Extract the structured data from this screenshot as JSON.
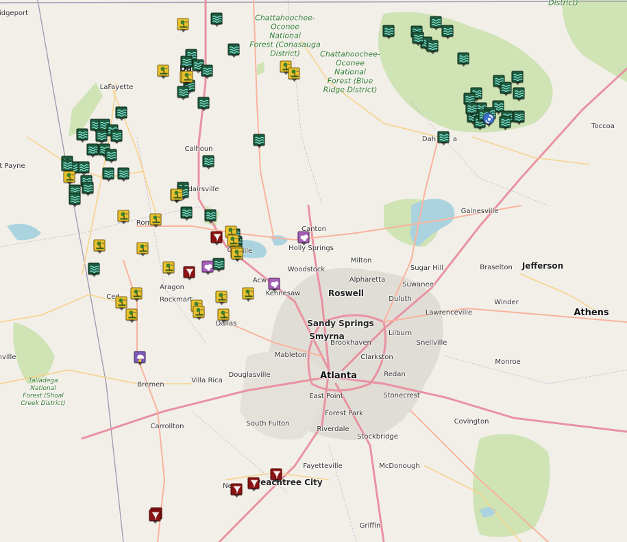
{
  "map": {
    "colors": {
      "land": "#f2efe9",
      "forest": "#c8dfad",
      "urban": "#dedbd6",
      "water": "#aad3df",
      "interstate": "#e892a2",
      "highway": "#f9b29c",
      "road": "#f7d28a"
    },
    "places": [
      {
        "name": "Bridgeport",
        "label": "idgeport"
      },
      {
        "name": "LaFayette",
        "label": "LaFayette"
      },
      {
        "name": "Fort Payne",
        "label": "t Payne"
      },
      {
        "name": "Dalton",
        "label": "Da"
      },
      {
        "name": "Calhoun",
        "label": "Calhoun"
      },
      {
        "name": "Adairsville",
        "label": "dairsville"
      },
      {
        "name": "Rome",
        "label": "Rom"
      },
      {
        "name": "Cartersville",
        "label": "Ca"
      },
      {
        "name": "Cartersville suffix",
        "label": "ville"
      },
      {
        "name": "Aragon",
        "label": "Aragon"
      },
      {
        "name": "Rockmart",
        "label": "Rockmart"
      },
      {
        "name": "Cedartown",
        "label": "Ced"
      },
      {
        "name": "Dallas",
        "label": "Dallas"
      },
      {
        "name": "Canton",
        "label": "Canton"
      },
      {
        "name": "Holly Springs",
        "label": "Holly Springs"
      },
      {
        "name": "Woodstock",
        "label": "Woodstock"
      },
      {
        "name": "Acworth",
        "label": "Acw"
      },
      {
        "name": "Kennesaw",
        "label": "Kennesaw"
      },
      {
        "name": "Milton",
        "label": "Milton"
      },
      {
        "name": "Alpharetta",
        "label": "Alpharetta"
      },
      {
        "name": "Roswell",
        "label": "Roswell"
      },
      {
        "name": "Sandy Springs",
        "label": "Sandy Springs"
      },
      {
        "name": "Smyrna",
        "label": "Smyrna"
      },
      {
        "name": "Brookhaven",
        "label": "Brookhaven"
      },
      {
        "name": "Mableton",
        "label": "Mableton"
      },
      {
        "name": "Atlanta",
        "label": "Atlanta"
      },
      {
        "name": "Douglasville",
        "label": "Douglasville"
      },
      {
        "name": "East Point",
        "label": "East Point"
      },
      {
        "name": "Forest Park",
        "label": "Forest Park"
      },
      {
        "name": "South Fulton",
        "label": "South Fulton"
      },
      {
        "name": "Riverdale",
        "label": "Riverdale"
      },
      {
        "name": "Stockbridge",
        "label": "Stockbridge"
      },
      {
        "name": "Fayetteville",
        "label": "Fayetteville"
      },
      {
        "name": "McDonough",
        "label": "McDonough"
      },
      {
        "name": "Peachtree City",
        "label": "Peachtree City"
      },
      {
        "name": "Newnan",
        "label": "Ne"
      },
      {
        "name": "Griffin",
        "label": "Griffin"
      },
      {
        "name": "Carrollton",
        "label": "Carrollton"
      },
      {
        "name": "Bremen",
        "label": "Bremen"
      },
      {
        "name": "Villa Rica",
        "label": "Villa Rica"
      },
      {
        "name": "Anniston",
        "label": "nville"
      },
      {
        "name": "Duluth",
        "label": "Duluth"
      },
      {
        "name": "Suwanee",
        "label": "Suwanee"
      },
      {
        "name": "Sugar Hill",
        "label": "Sugar Hill"
      },
      {
        "name": "Lawrenceville",
        "label": "Lawrenceville"
      },
      {
        "name": "Lilburn",
        "label": "Lilburn"
      },
      {
        "name": "Snellville",
        "label": "Snellville"
      },
      {
        "name": "Clarkston",
        "label": "Clarkston"
      },
      {
        "name": "Redan",
        "label": "Redan"
      },
      {
        "name": "Stonecrest",
        "label": "Stonecrest"
      },
      {
        "name": "Covington",
        "label": "Covington"
      },
      {
        "name": "Monroe",
        "label": "Monroe"
      },
      {
        "name": "Winder",
        "label": "Winder"
      },
      {
        "name": "Braselton",
        "label": "Braselton"
      },
      {
        "name": "Jefferson",
        "label": "Jefferson"
      },
      {
        "name": "Athens",
        "label": "Athens"
      },
      {
        "name": "Gainesville",
        "label": "Gainesville"
      },
      {
        "name": "Dahlonega",
        "label": "Dah"
      },
      {
        "name": "Dahlonega suffix",
        "label": "a"
      },
      {
        "name": "Toccoa",
        "label": "Toccoa"
      }
    ],
    "forests": [
      {
        "name": "Chattahoochee-Oconee NF Conasauga",
        "lines": [
          "Chattahoochee-",
          "Oconee",
          "National",
          "Forest (Conasauga",
          "District)"
        ]
      },
      {
        "name": "Chattahoochee-Oconee NF Blue Ridge",
        "lines": [
          "Chattahoochee-",
          "Oconee",
          "National",
          "Forest (Blue",
          "Ridge District)"
        ]
      },
      {
        "name": "Talladega NF Shoal Creek",
        "lines": [
          "Talladega",
          "National",
          "Forest (Shoal",
          "Creek District)"
        ]
      },
      {
        "name": "District top right",
        "lines": [
          "District)"
        ]
      }
    ],
    "event_types": [
      "flood",
      "wind",
      "tornado",
      "hail",
      "tstorm",
      "hurricane"
    ],
    "events": [
      {
        "type": "flood"
      },
      {
        "type": "flood"
      },
      {
        "type": "flood"
      },
      {
        "type": "flood"
      },
      {
        "type": "flood"
      },
      {
        "type": "flood"
      },
      {
        "type": "flood"
      },
      {
        "type": "flood"
      },
      {
        "type": "flood"
      },
      {
        "type": "flood"
      },
      {
        "type": "flood"
      },
      {
        "type": "flood"
      },
      {
        "type": "flood"
      },
      {
        "type": "flood"
      },
      {
        "type": "flood"
      },
      {
        "type": "flood"
      },
      {
        "type": "flood"
      },
      {
        "type": "flood"
      },
      {
        "type": "flood"
      },
      {
        "type": "flood"
      },
      {
        "type": "flood"
      },
      {
        "type": "flood"
      },
      {
        "type": "flood"
      },
      {
        "type": "flood"
      },
      {
        "type": "flood"
      },
      {
        "type": "flood"
      },
      {
        "type": "flood"
      },
      {
        "type": "flood"
      },
      {
        "type": "flood"
      },
      {
        "type": "flood"
      },
      {
        "type": "flood"
      },
      {
        "type": "flood"
      },
      {
        "type": "flood"
      },
      {
        "type": "flood"
      },
      {
        "type": "flood"
      },
      {
        "type": "flood"
      },
      {
        "type": "flood"
      },
      {
        "type": "flood"
      },
      {
        "type": "flood"
      },
      {
        "type": "flood"
      },
      {
        "type": "flood"
      },
      {
        "type": "flood"
      },
      {
        "type": "flood"
      },
      {
        "type": "flood"
      },
      {
        "type": "flood"
      },
      {
        "type": "flood"
      },
      {
        "type": "flood"
      },
      {
        "type": "flood"
      },
      {
        "type": "flood"
      },
      {
        "type": "flood"
      },
      {
        "type": "flood"
      },
      {
        "type": "flood"
      },
      {
        "type": "flood"
      },
      {
        "type": "flood"
      },
      {
        "type": "flood"
      },
      {
        "type": "flood"
      },
      {
        "type": "flood"
      },
      {
        "type": "flood"
      },
      {
        "type": "flood"
      },
      {
        "type": "flood"
      },
      {
        "type": "flood"
      },
      {
        "type": "flood"
      },
      {
        "type": "flood"
      },
      {
        "type": "flood"
      },
      {
        "type": "flood"
      },
      {
        "type": "wind"
      },
      {
        "type": "wind"
      },
      {
        "type": "wind"
      },
      {
        "type": "wind"
      },
      {
        "type": "wind"
      },
      {
        "type": "wind"
      },
      {
        "type": "wind"
      },
      {
        "type": "wind"
      },
      {
        "type": "wind"
      },
      {
        "type": "wind"
      },
      {
        "type": "wind"
      },
      {
        "type": "wind"
      },
      {
        "type": "wind"
      },
      {
        "type": "wind"
      },
      {
        "type": "wind"
      },
      {
        "type": "wind"
      },
      {
        "type": "wind"
      },
      {
        "type": "wind"
      },
      {
        "type": "wind"
      },
      {
        "type": "wind"
      },
      {
        "type": "wind"
      },
      {
        "type": "wind"
      },
      {
        "type": "wind"
      },
      {
        "type": "wind"
      },
      {
        "type": "wind"
      },
      {
        "type": "wind"
      },
      {
        "type": "tornado"
      },
      {
        "type": "tornado"
      },
      {
        "type": "tornado"
      },
      {
        "type": "tornado"
      },
      {
        "type": "tornado"
      },
      {
        "type": "tornado"
      },
      {
        "type": "tornado"
      },
      {
        "type": "hail"
      },
      {
        "type": "hail"
      },
      {
        "type": "hail"
      },
      {
        "type": "tstorm"
      },
      {
        "type": "hurricane"
      }
    ]
  }
}
